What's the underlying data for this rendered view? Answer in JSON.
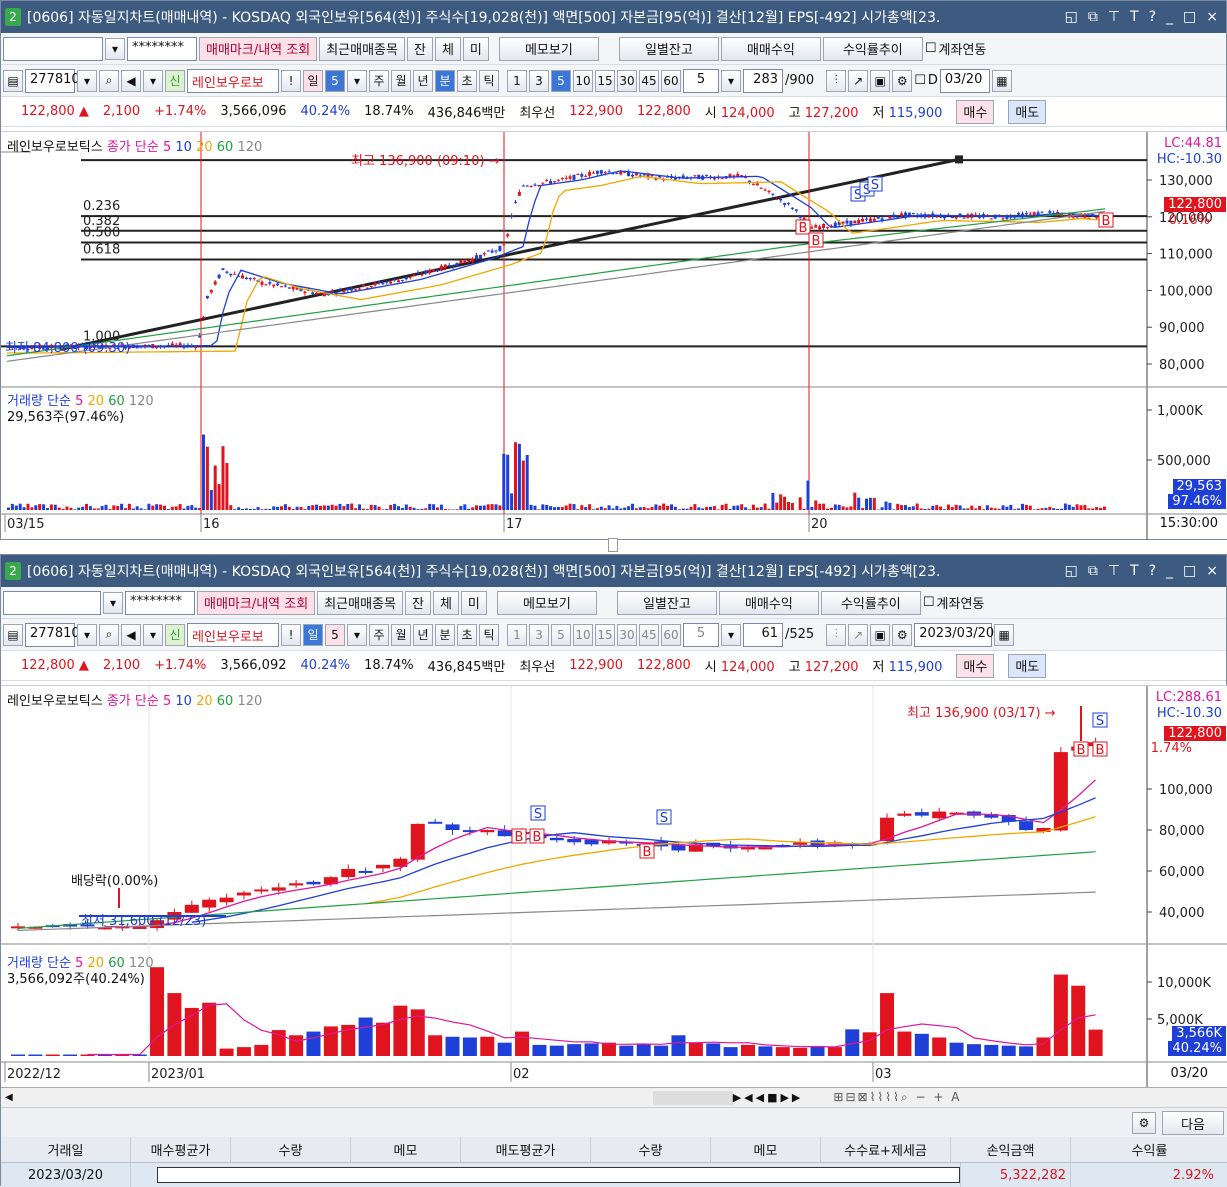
{
  "title": "[0606] 자동일지차트(매매내역) - KOSDAQ 외국인보유[564(천)] 주식수[19,028(천)] 액면[500] 자본금[95(억)] 결산[12월] EPS[-492] 시가총액[23.",
  "win_num": "2",
  "controls": {
    "min": "_",
    "max": "□",
    "close": "×",
    "help": "?",
    "t": "T"
  },
  "toolbar1": {
    "password": "********",
    "btn_trade": "매매마크/내역 조회",
    "btn_recent": "최근매매종목",
    "btn_jan": "잔",
    "btn_che": "체",
    "btn_mi": "미",
    "btn_memo": "메모보기",
    "btn_daily": "일별잔고",
    "btn_profit": "매매수익",
    "btn_rate": "수익률추이",
    "chk_account": "계좌연동"
  },
  "toolbar2_top": {
    "code": "277810",
    "sin": "신",
    "name": "레인보우로보",
    "excl": "!",
    "day": "일",
    "per": "5",
    "wk": "주",
    "mo": "월",
    "yr": "년",
    "bun": "분",
    "cho": "초",
    "tik": "틱",
    "p1": "1",
    "p3": "3",
    "p5": "5",
    "p10": "10",
    "p15": "15",
    "p30": "30",
    "p45": "45",
    "p60": "60",
    "cnt": "5",
    "bars": "283",
    "tot": "/900",
    "d": "D",
    "date": "03/20"
  },
  "toolbar2_bot": {
    "code": "277810",
    "sin": "신",
    "name": "레인보우로보",
    "excl": "!",
    "day": "일",
    "per": "5",
    "wk": "주",
    "mo": "월",
    "yr": "년",
    "bun": "분",
    "cho": "초",
    "tik": "틱",
    "p1": "1",
    "p3": "3",
    "p5": "5",
    "p10": "10",
    "p15": "15",
    "p30": "30",
    "p45": "45",
    "p60": "60",
    "cnt": "5",
    "bars": "61",
    "tot": "/525",
    "date": "2023/03/20"
  },
  "quote_top": {
    "price": "122,800",
    "arrow": "▲",
    "chg": "2,100",
    "pct": "+1.74%",
    "vol": "3,566,096",
    "volpct": "40.24%",
    "turn": "18.74%",
    "amt": "436,846백만",
    "best": "최우선",
    "ask": "122,900",
    "bid": "122,800",
    "o_l": "시",
    "o": "124,000",
    "h_l": "고",
    "h": "127,200",
    "l_l": "저",
    "l": "115,900",
    "buy": "매수",
    "sell": "매도"
  },
  "quote_bot": {
    "price": "122,800",
    "arrow": "▲",
    "chg": "2,100",
    "pct": "+1.74%",
    "vol": "3,566,092",
    "volpct": "40.24%",
    "turn": "18.74%",
    "amt": "436,845백만",
    "best": "최우선",
    "ask": "122,900",
    "bid": "122,800",
    "o_l": "시",
    "o": "124,000",
    "h_l": "고",
    "h": "127,200",
    "l_l": "저",
    "l": "115,900",
    "buy": "매수",
    "sell": "매도"
  },
  "top_chart": {
    "legend_name": "레인보우로보틱스",
    "legend_ma": "종가 단순",
    "ma5": "5",
    "ma10": "10",
    "ma20": "20",
    "ma60": "60",
    "ma120": "120",
    "lc": "LC:44.81",
    "hc": "HC:-10.30",
    "price_tag": "122,800",
    "price_pct": "0.16%",
    "yaxis": [
      "130,000",
      "120,000",
      "110,000",
      "100,000",
      "90,000",
      "80,000"
    ],
    "fib": [
      "0.236",
      "0.382",
      "0.500",
      "0.618",
      "1.000"
    ],
    "high_note": "최고 136,900 (09:10) →",
    "low_note": "최저 84,800 (09:30)",
    "vol_legend": "거래량 단순",
    "v5": "5",
    "v20": "20",
    "v60": "60",
    "v120": "120",
    "vol_value": "29,563주(97.46%)",
    "vol_axis": [
      "1,000K",
      "500,000"
    ],
    "vol_tag": "29,563",
    "vol_tag2": "97.46%",
    "xaxis": [
      "03/15",
      "16",
      "17",
      "20"
    ],
    "time": "15:30:00",
    "marks": {
      "b": "B",
      "s": "S"
    }
  },
  "bottom_chart": {
    "legend_name": "레인보우로보틱스",
    "legend_ma": "종가 단순",
    "ma5": "5",
    "ma10": "10",
    "ma20": "20",
    "ma60": "60",
    "ma120": "120",
    "lc": "LC:288.61",
    "hc": "HC:-10.30",
    "price_tag": "122,800",
    "price_pct": "1.74%",
    "yaxis": [
      "100,000",
      "80,000",
      "60,000",
      "40,000"
    ],
    "high_note": "최고 136,900 (03/17) →",
    "low_note": "최저 31,600 (12/23)",
    "div_note": "배당락(0.00%)",
    "vol_legend": "거래량 단순",
    "v5": "5",
    "v20": "20",
    "v60": "60",
    "v120": "120",
    "vol_value": "3,566,092주(40.24%)",
    "vol_axis": [
      "10,000K",
      "5,000K"
    ],
    "vol_tag": "3,566K",
    "vol_tag2": "40.24%",
    "xaxis": [
      "2022/12",
      "2023/01",
      "02",
      "03"
    ],
    "end": "03/20",
    "marks": {
      "b": "B",
      "s": "S"
    }
  },
  "table": {
    "next": "다음",
    "headers": [
      "거래일",
      "매수평균가",
      "수량",
      "메모",
      "매도평균가",
      "수량",
      "메모",
      "수수료+제세금",
      "손익금액",
      "수익률"
    ],
    "row": {
      "date": "2023/03/20",
      "pl": "5,322,282",
      "rate": "2.92%"
    }
  },
  "colors": {
    "up": "#e0141e",
    "down": "#1e3fd8",
    "ma5": "#e0179a",
    "ma10": "#1e3fd8",
    "ma20": "#f0a800",
    "ma60": "#20a040",
    "ma120": "#888888"
  }
}
